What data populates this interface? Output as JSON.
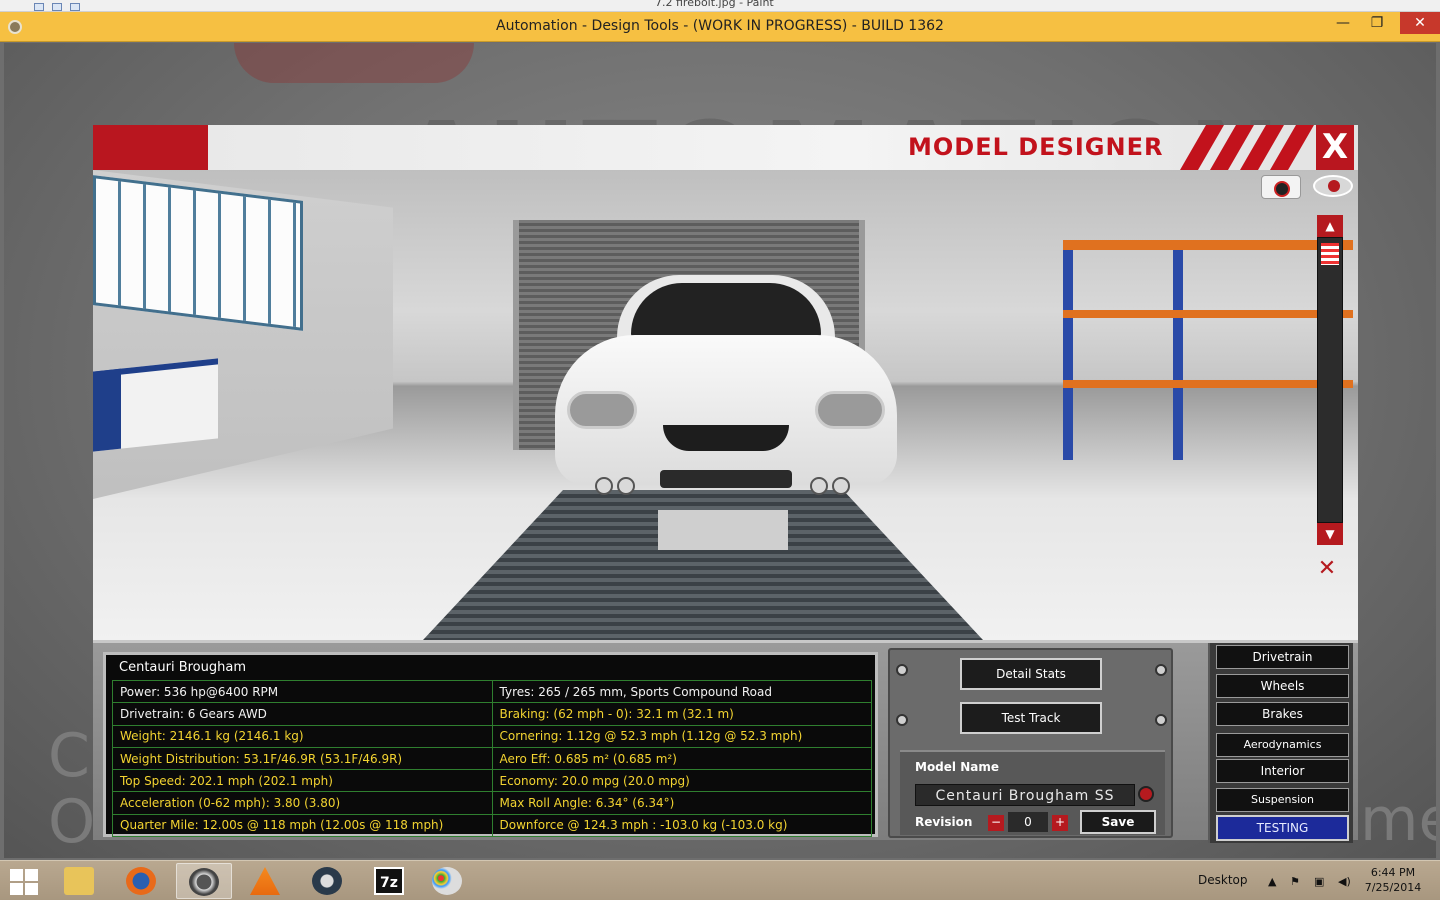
{
  "paint": {
    "title": "7.2 firebolt.jpg - Paint"
  },
  "window": {
    "title": "Automation - Design Tools - (WORK IN PROGRESS) - BUILD 1362",
    "min": "—",
    "max": "❐",
    "close": "✕"
  },
  "background": {
    "logo": "AUTOMATION",
    "left_text": "C\nO",
    "right_text": "me"
  },
  "designer": {
    "title": "MODEL DESIGNER",
    "close": "X"
  },
  "viewport": {
    "scroll_up": "▲",
    "scroll_down": "▼",
    "reset": "✕"
  },
  "stats": {
    "name": "Centauri Brougham",
    "rows": [
      {
        "left": "Power: 536 hp@6400 RPM",
        "right": "Tyres: 265 / 265 mm, Sports Compound Road",
        "left_color": "white",
        "right_color": "white"
      },
      {
        "left": "Drivetrain: 6 Gears AWD",
        "right": "Braking: (62 mph - 0): 32.1 m (32.1 m)",
        "left_color": "white",
        "right_color": "yellow"
      },
      {
        "left": "Weight: 2146.1 kg (2146.1 kg)",
        "right": "Cornering: 1.12g @ 52.3 mph (1.12g @ 52.3 mph)",
        "left_color": "yellow",
        "right_color": "yellow"
      },
      {
        "left": "Weight Distribution: 53.1F/46.9R (53.1F/46.9R)",
        "right": "Aero Eff: 0.685 m² (0.685 m²)",
        "left_color": "yellow",
        "right_color": "yellow"
      },
      {
        "left": "Top Speed: 202.1 mph (202.1 mph)",
        "right": "Economy: 20.0 mpg (20.0 mpg)",
        "left_color": "yellow",
        "right_color": "yellow"
      },
      {
        "left": "Acceleration (0-62 mph): 3.80 (3.80)",
        "right": "Max Roll Angle: 6.34° (6.34°)",
        "left_color": "yellow",
        "right_color": "yellow"
      },
      {
        "left": "Quarter Mile: 12.00s @ 118 mph (12.00s @ 118 mph)",
        "right": "Downforce @ 124.3 mph : -103.0 kg (-103.0 kg)",
        "left_color": "yellow",
        "right_color": "yellow"
      }
    ]
  },
  "actions": {
    "detail_stats": "Detail Stats",
    "test_track": "Test Track"
  },
  "model": {
    "label": "Model Name",
    "name": "Centauri Brougham SS",
    "revision_label": "Revision",
    "revision": "0",
    "minus": "−",
    "plus": "+",
    "save": "Save"
  },
  "categories": [
    "Drivetrain",
    "Wheels",
    "Brakes",
    "Aerodynamics",
    "Interior",
    "Suspension",
    "TESTING"
  ],
  "taskbar": {
    "desktop": "Desktop",
    "time": "6:44 PM",
    "date": "7/25/2014",
    "seven_zip": "7z"
  },
  "colors": {
    "accent_red": "#b9161f",
    "title_yellow": "#f6c042",
    "stat_yellow": "#f3d431",
    "grid_green": "#2f7f2f",
    "testing_blue": "#1c2a9a"
  }
}
